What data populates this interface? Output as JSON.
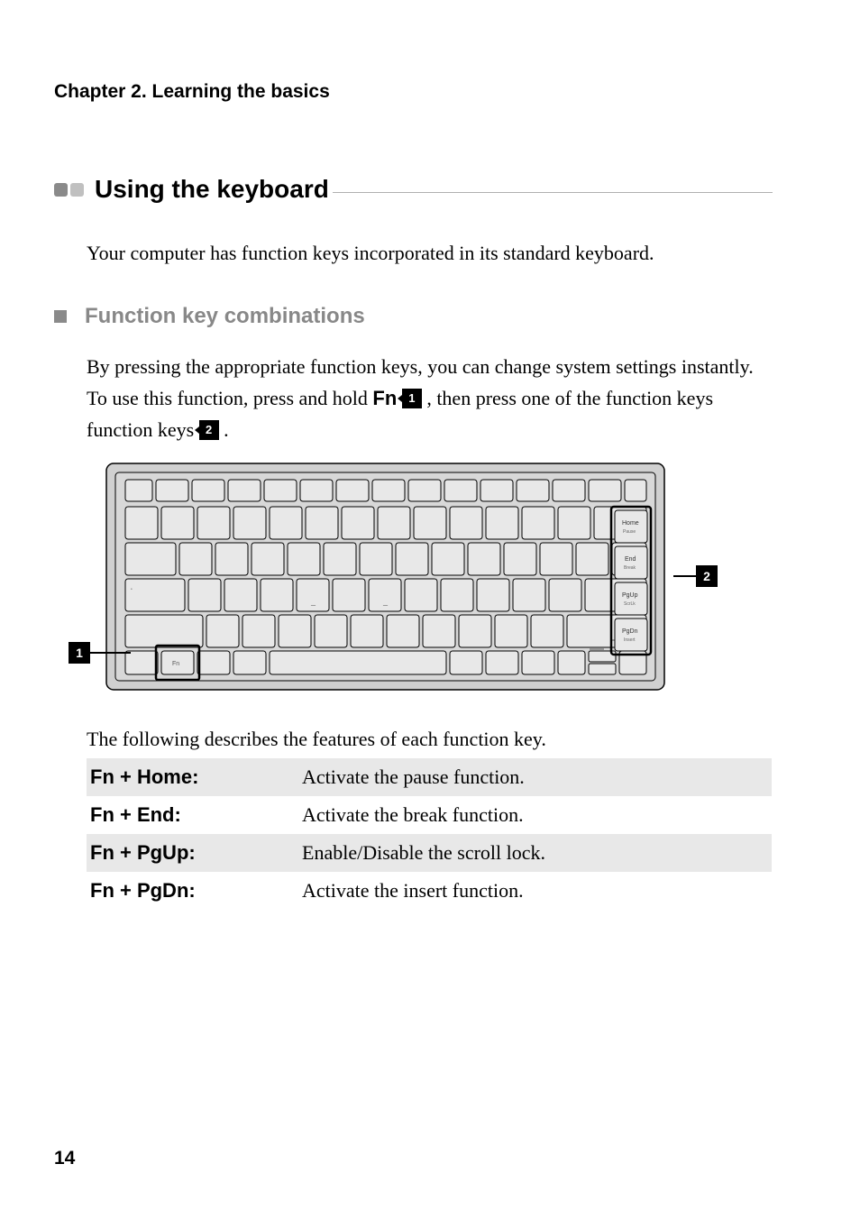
{
  "chapter_header": "Chapter 2. Learning the basics",
  "section": {
    "title": "Using the keyboard",
    "intro": "Your computer has function keys incorporated in its standard keyboard."
  },
  "subsection": {
    "title": "Function key combinations",
    "body_part1": "By pressing the appropriate function keys, you can change system settings instantly. To use this function, press and hold ",
    "fn_label": "Fn",
    "callout_1": "1",
    "body_part2": " , then press one of the function keys ",
    "callout_2": "2",
    "body_part3": " ."
  },
  "keyboard": {
    "label_1": "1",
    "label_2": "2",
    "fn_key": "Fn",
    "side_keys": [
      "Home",
      "Pause",
      "End",
      "Break",
      "PgUp",
      "ScrLk",
      "PgDn",
      "Insert"
    ]
  },
  "table": {
    "intro": "The following describes the features of each function key.",
    "rows": [
      {
        "key": "Fn + Home:",
        "desc": "Activate the pause function."
      },
      {
        "key": "Fn + End:",
        "desc": "Activate the break function."
      },
      {
        "key": "Fn + PgUp:",
        "desc": "Enable/Disable the scroll lock."
      },
      {
        "key": "Fn + PgDn:",
        "desc": "Activate the insert function."
      }
    ]
  },
  "page_number": "14"
}
